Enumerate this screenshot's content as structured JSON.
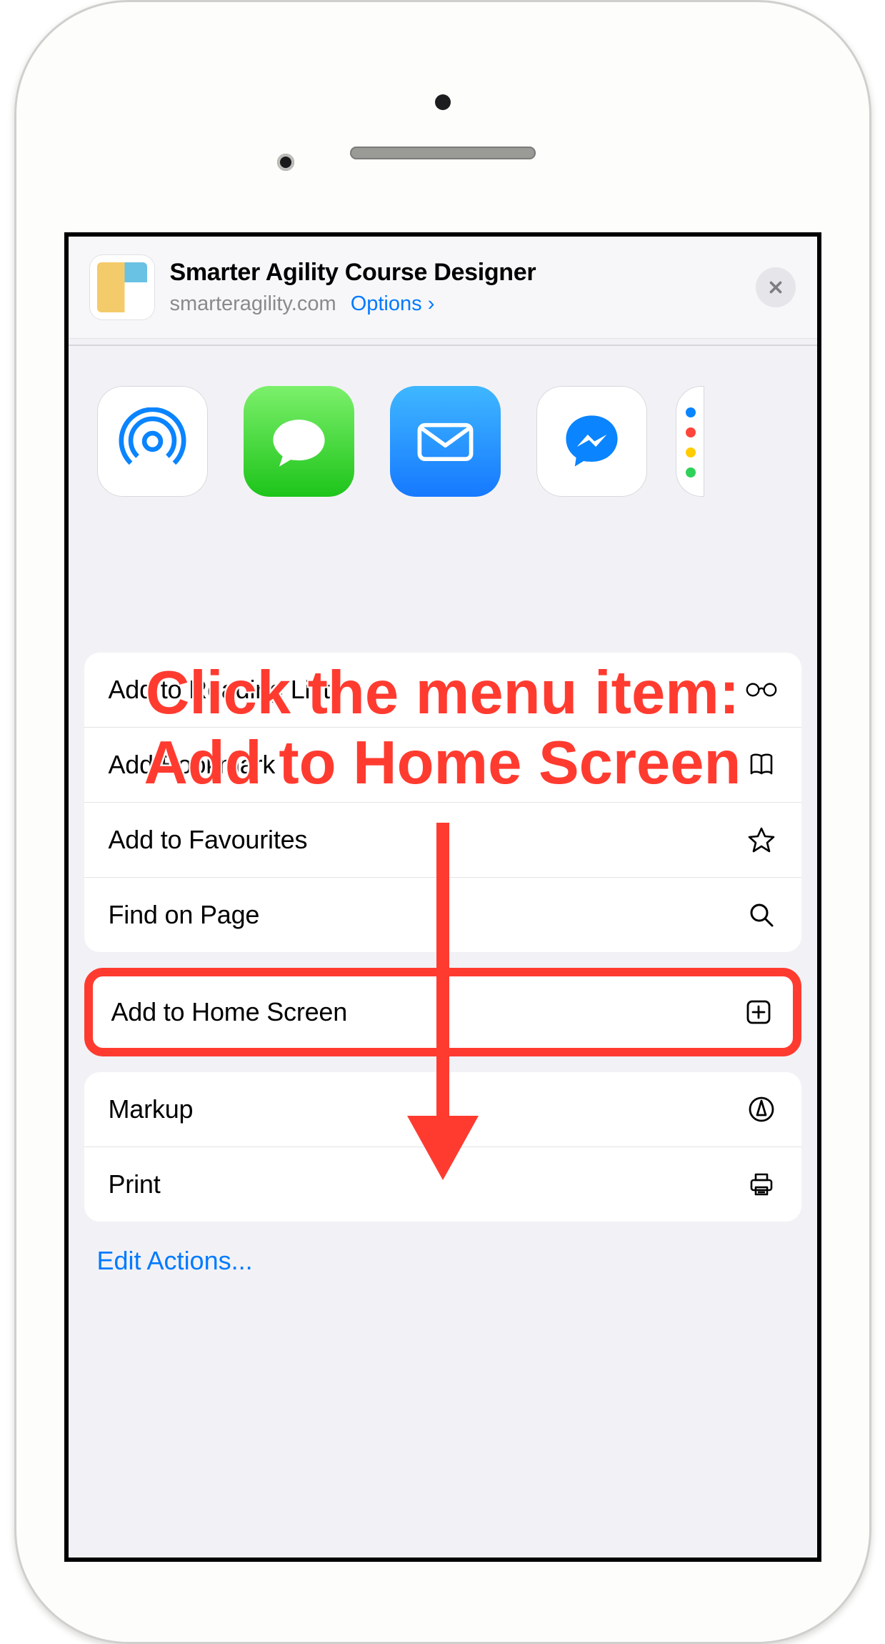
{
  "header": {
    "title": "Smarter Agility Course Designer",
    "domain": "smarteragility.com",
    "options_label": "Options"
  },
  "share_apps": [
    {
      "id": "airdrop",
      "label": "AirDrop"
    },
    {
      "id": "messages",
      "label": "Messages"
    },
    {
      "id": "mail",
      "label": "Mail"
    },
    {
      "id": "messenger",
      "label": "Messenger"
    }
  ],
  "annotation": {
    "line1": "Click the menu item:",
    "line2": "Add to Home Screen"
  },
  "actions_group1": [
    {
      "id": "reading-list",
      "label": "Add to Reading List",
      "icon": "glasses-icon"
    },
    {
      "id": "bookmark",
      "label": "Add Bookmark",
      "icon": "book-icon"
    },
    {
      "id": "favourites",
      "label": "Add to Favourites",
      "icon": "star-icon"
    },
    {
      "id": "find-on-page",
      "label": "Find on Page",
      "icon": "search-icon"
    }
  ],
  "action_highlighted": {
    "id": "add-home-screen",
    "label": "Add to Home Screen",
    "icon": "plus-square-icon"
  },
  "actions_group2": [
    {
      "id": "markup",
      "label": "Markup",
      "icon": "markup-icon"
    },
    {
      "id": "print",
      "label": "Print",
      "icon": "printer-icon"
    }
  ],
  "edit_actions_label": "Edit Actions..."
}
